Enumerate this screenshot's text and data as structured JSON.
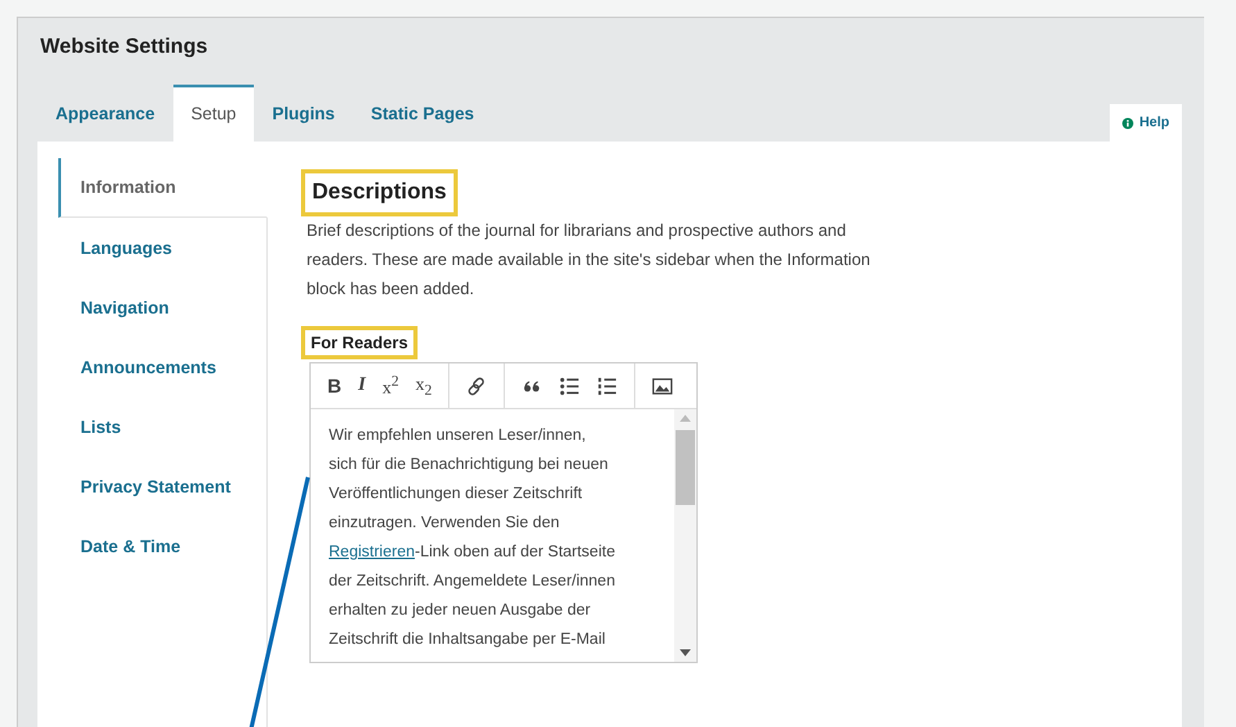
{
  "page_title": "Website Settings",
  "tabs": [
    {
      "label": "Appearance",
      "selected": false
    },
    {
      "label": "Setup",
      "selected": true
    },
    {
      "label": "Plugins",
      "selected": false
    },
    {
      "label": "Static Pages",
      "selected": false
    }
  ],
  "help": {
    "label": "Help"
  },
  "sidebar": {
    "items": [
      {
        "label": "Information",
        "selected": true
      },
      {
        "label": "Languages",
        "selected": false
      },
      {
        "label": "Navigation",
        "selected": false
      },
      {
        "label": "Announcements",
        "selected": false
      },
      {
        "label": "Lists",
        "selected": false
      },
      {
        "label": "Privacy Statement",
        "selected": false
      },
      {
        "label": "Date & Time",
        "selected": false
      }
    ]
  },
  "section": {
    "title": "Descriptions",
    "highlighted": true,
    "description": "Brief descriptions of the journal for librarians and prospective authors and readers. These are made available in the site's sidebar when the Information block has been added."
  },
  "field": {
    "label": "For Readers",
    "highlighted": true,
    "toolbar": [
      {
        "kind": "bold",
        "label": "B"
      },
      {
        "kind": "italic",
        "label": "I"
      },
      {
        "kind": "glyph",
        "label": "x$^{2}$"
      },
      {
        "kind": "glyph",
        "label": "x$_{2}$"
      },
      {
        "kind": "separator"
      },
      {
        "kind": "link"
      },
      {
        "kind": "separator"
      },
      {
        "kind": "quote"
      },
      {
        "kind": "bullets"
      },
      {
        "kind": "numbers"
      },
      {
        "kind": "separator"
      },
      {
        "kind": "image"
      }
    ],
    "lines": [
      {
        "text": "Wir empfehlen unseren Leser/innen,"
      },
      {
        "text": "sich für die Benachrichtigung bei neuen"
      },
      {
        "text": "Veröffentlichungen dieser Zeitschrift"
      },
      {
        "text": "einzutragen. Verwenden Sie den"
      },
      {
        "link": "Registrieren",
        "text": "-Link oben auf der Startseite"
      },
      {
        "text": "der Zeitschrift. Angemeldete Leser/innen"
      },
      {
        "text": "erhalten zu jeder neuen Ausgabe der"
      },
      {
        "text": "Zeitschrift die Inhaltsangabe per E-Mail"
      }
    ]
  }
}
